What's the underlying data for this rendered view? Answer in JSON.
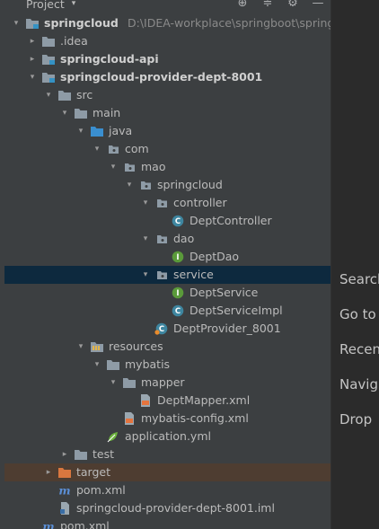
{
  "toolbar": {
    "title": "Project"
  },
  "tree": [
    {
      "label": "springcloud",
      "path": "D:\\IDEA-workplace\\springboot\\springcloud",
      "depth": 0,
      "expanded": true,
      "icon": "module-folder-icon",
      "bold": true
    },
    {
      "label": ".idea",
      "depth": 1,
      "expanded": false,
      "icon": "folder-icon"
    },
    {
      "label": "springcloud-api",
      "depth": 1,
      "expanded": false,
      "icon": "module-folder-icon",
      "bold": true
    },
    {
      "label": "springcloud-provider-dept-8001",
      "depth": 1,
      "expanded": true,
      "icon": "module-folder-icon",
      "bold": true
    },
    {
      "label": "src",
      "depth": 2,
      "expanded": true,
      "icon": "folder-icon"
    },
    {
      "label": "main",
      "depth": 3,
      "expanded": true,
      "icon": "folder-icon"
    },
    {
      "label": "java",
      "depth": 4,
      "expanded": true,
      "icon": "source-folder-icon"
    },
    {
      "label": "com",
      "depth": 5,
      "expanded": true,
      "icon": "package-icon"
    },
    {
      "label": "mao",
      "depth": 6,
      "expanded": true,
      "icon": "package-icon"
    },
    {
      "label": "springcloud",
      "depth": 7,
      "expanded": true,
      "icon": "package-icon"
    },
    {
      "label": "controller",
      "depth": 8,
      "expanded": true,
      "icon": "package-icon"
    },
    {
      "label": "DeptController",
      "depth": 9,
      "icon": "class-icon"
    },
    {
      "label": "dao",
      "depth": 8,
      "expanded": true,
      "icon": "package-icon"
    },
    {
      "label": "DeptDao",
      "depth": 9,
      "icon": "interface-icon"
    },
    {
      "label": "service",
      "depth": 8,
      "expanded": true,
      "icon": "package-icon",
      "selected": true
    },
    {
      "label": "DeptService",
      "depth": 9,
      "icon": "interface-icon"
    },
    {
      "label": "DeptServiceImpl",
      "depth": 9,
      "icon": "class-icon"
    },
    {
      "label": "DeptProvider_8001",
      "depth": 8,
      "icon": "spring-boot-class-icon"
    },
    {
      "label": "resources",
      "depth": 4,
      "expanded": true,
      "icon": "resources-folder-icon"
    },
    {
      "label": "mybatis",
      "depth": 5,
      "expanded": true,
      "icon": "folder-icon"
    },
    {
      "label": "mapper",
      "depth": 6,
      "expanded": true,
      "icon": "folder-icon"
    },
    {
      "label": "DeptMapper.xml",
      "depth": 7,
      "icon": "xml-file-icon"
    },
    {
      "label": "mybatis-config.xml",
      "depth": 6,
      "icon": "xml-file-icon"
    },
    {
      "label": "application.yml",
      "depth": 5,
      "icon": "spring-yml-icon"
    },
    {
      "label": "test",
      "depth": 3,
      "expanded": false,
      "icon": "folder-icon"
    },
    {
      "label": "target",
      "depth": 2,
      "expanded": false,
      "icon": "excluded-folder-icon",
      "highlighted": true
    },
    {
      "label": "pom.xml",
      "depth": 2,
      "icon": "maven-icon"
    },
    {
      "label": "springcloud-provider-dept-8001.iml",
      "depth": 2,
      "icon": "iml-file-icon"
    },
    {
      "label": "pom.xml",
      "depth": 1,
      "icon": "maven-icon"
    }
  ],
  "hints": [
    "Search",
    "Go to",
    "Recen",
    "Navig",
    "Drop"
  ]
}
